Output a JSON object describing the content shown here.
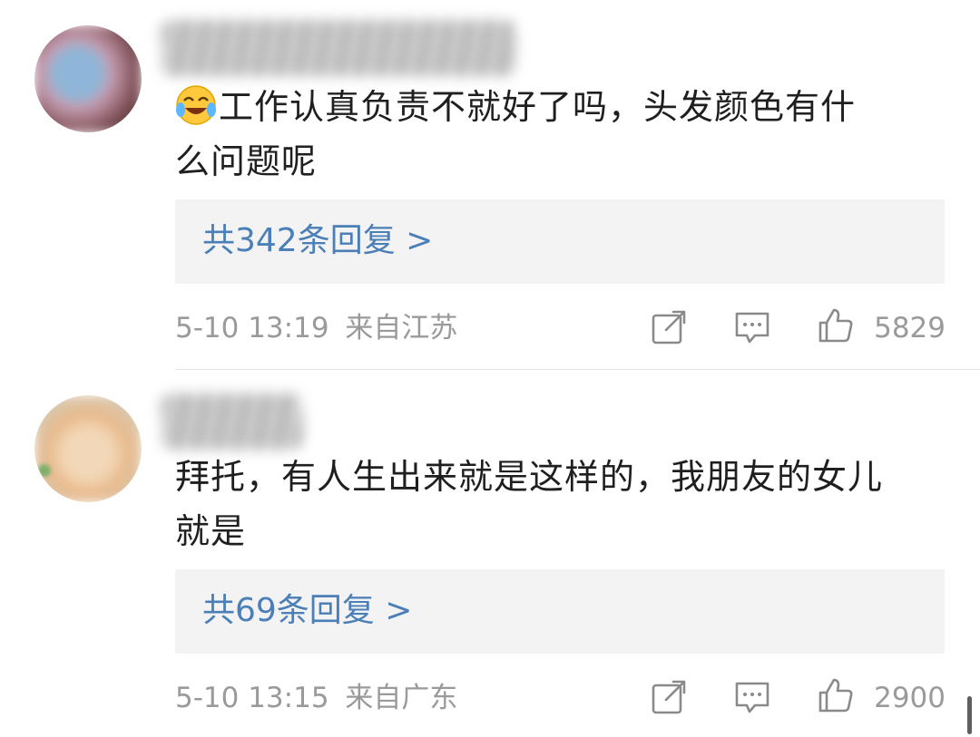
{
  "comments": [
    {
      "text_line1": "工作认真负责不就好了吗，头发颜色有什",
      "text_line2": "么问题呢",
      "leading_emoji": "laugh-cry-emoji",
      "replies_label": "共342条回复 >",
      "date": "5-10 13:19",
      "location": "来自江苏",
      "likes": "5829"
    },
    {
      "text_line1": "拜托，有人生出来就是这样的，我朋友的女儿",
      "text_line2": "就是",
      "replies_label": "共69条回复 >",
      "date": "5-10 13:15",
      "location": "来自广东",
      "likes": "2900"
    }
  ],
  "icons": {
    "share": "share-icon",
    "comment": "comment-icon",
    "like": "thumbs-up-icon"
  },
  "colors": {
    "link": "#4b7fb7",
    "meta": "#9a9a9a",
    "reply_box": "#f3f3f3",
    "text": "#1f1f1f"
  }
}
